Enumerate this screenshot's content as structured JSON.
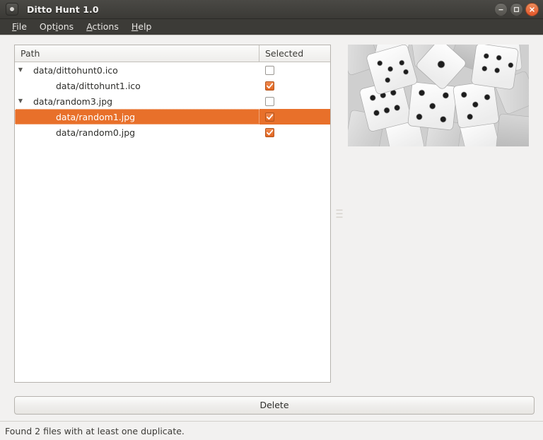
{
  "window": {
    "title": "Ditto Hunt 1.0",
    "icon": "app-dot-icon",
    "controls": {
      "minimize": "minimize-icon",
      "maximize": "maximize-icon",
      "close": "close-icon"
    }
  },
  "menubar": {
    "items": [
      {
        "label": "File",
        "mnemonic": "F"
      },
      {
        "label": "Options",
        "mnemonic": "i"
      },
      {
        "label": "Actions",
        "mnemonic": "A"
      },
      {
        "label": "Help",
        "mnemonic": "H"
      }
    ]
  },
  "tree": {
    "columns": [
      {
        "label": "Path"
      },
      {
        "label": "Selected"
      }
    ],
    "rows": [
      {
        "label": "data/dittohunt0.ico",
        "level": 0,
        "expander": "▼",
        "checked": false,
        "selected": false
      },
      {
        "label": "data/dittohunt1.ico",
        "level": 1,
        "expander": "",
        "checked": true,
        "selected": false
      },
      {
        "label": "data/random3.jpg",
        "level": 0,
        "expander": "▼",
        "checked": false,
        "selected": false
      },
      {
        "label": "data/random1.jpg",
        "level": 1,
        "expander": "",
        "checked": true,
        "selected": true
      },
      {
        "label": "data/random0.jpg",
        "level": 1,
        "expander": "",
        "checked": true,
        "selected": false
      }
    ]
  },
  "splitter": {
    "grip": "splitter-grip-icon"
  },
  "preview": {
    "alt": "dice-photo-preview"
  },
  "actions": {
    "delete_label": "Delete"
  },
  "status": {
    "text": "Found 2 files with at least one duplicate."
  },
  "colors": {
    "accent": "#e8702a",
    "titlebar": "#3b3a36",
    "menubar": "#3c3b37",
    "window_bg": "#f2f1f0",
    "close_button": "#e2562a"
  }
}
